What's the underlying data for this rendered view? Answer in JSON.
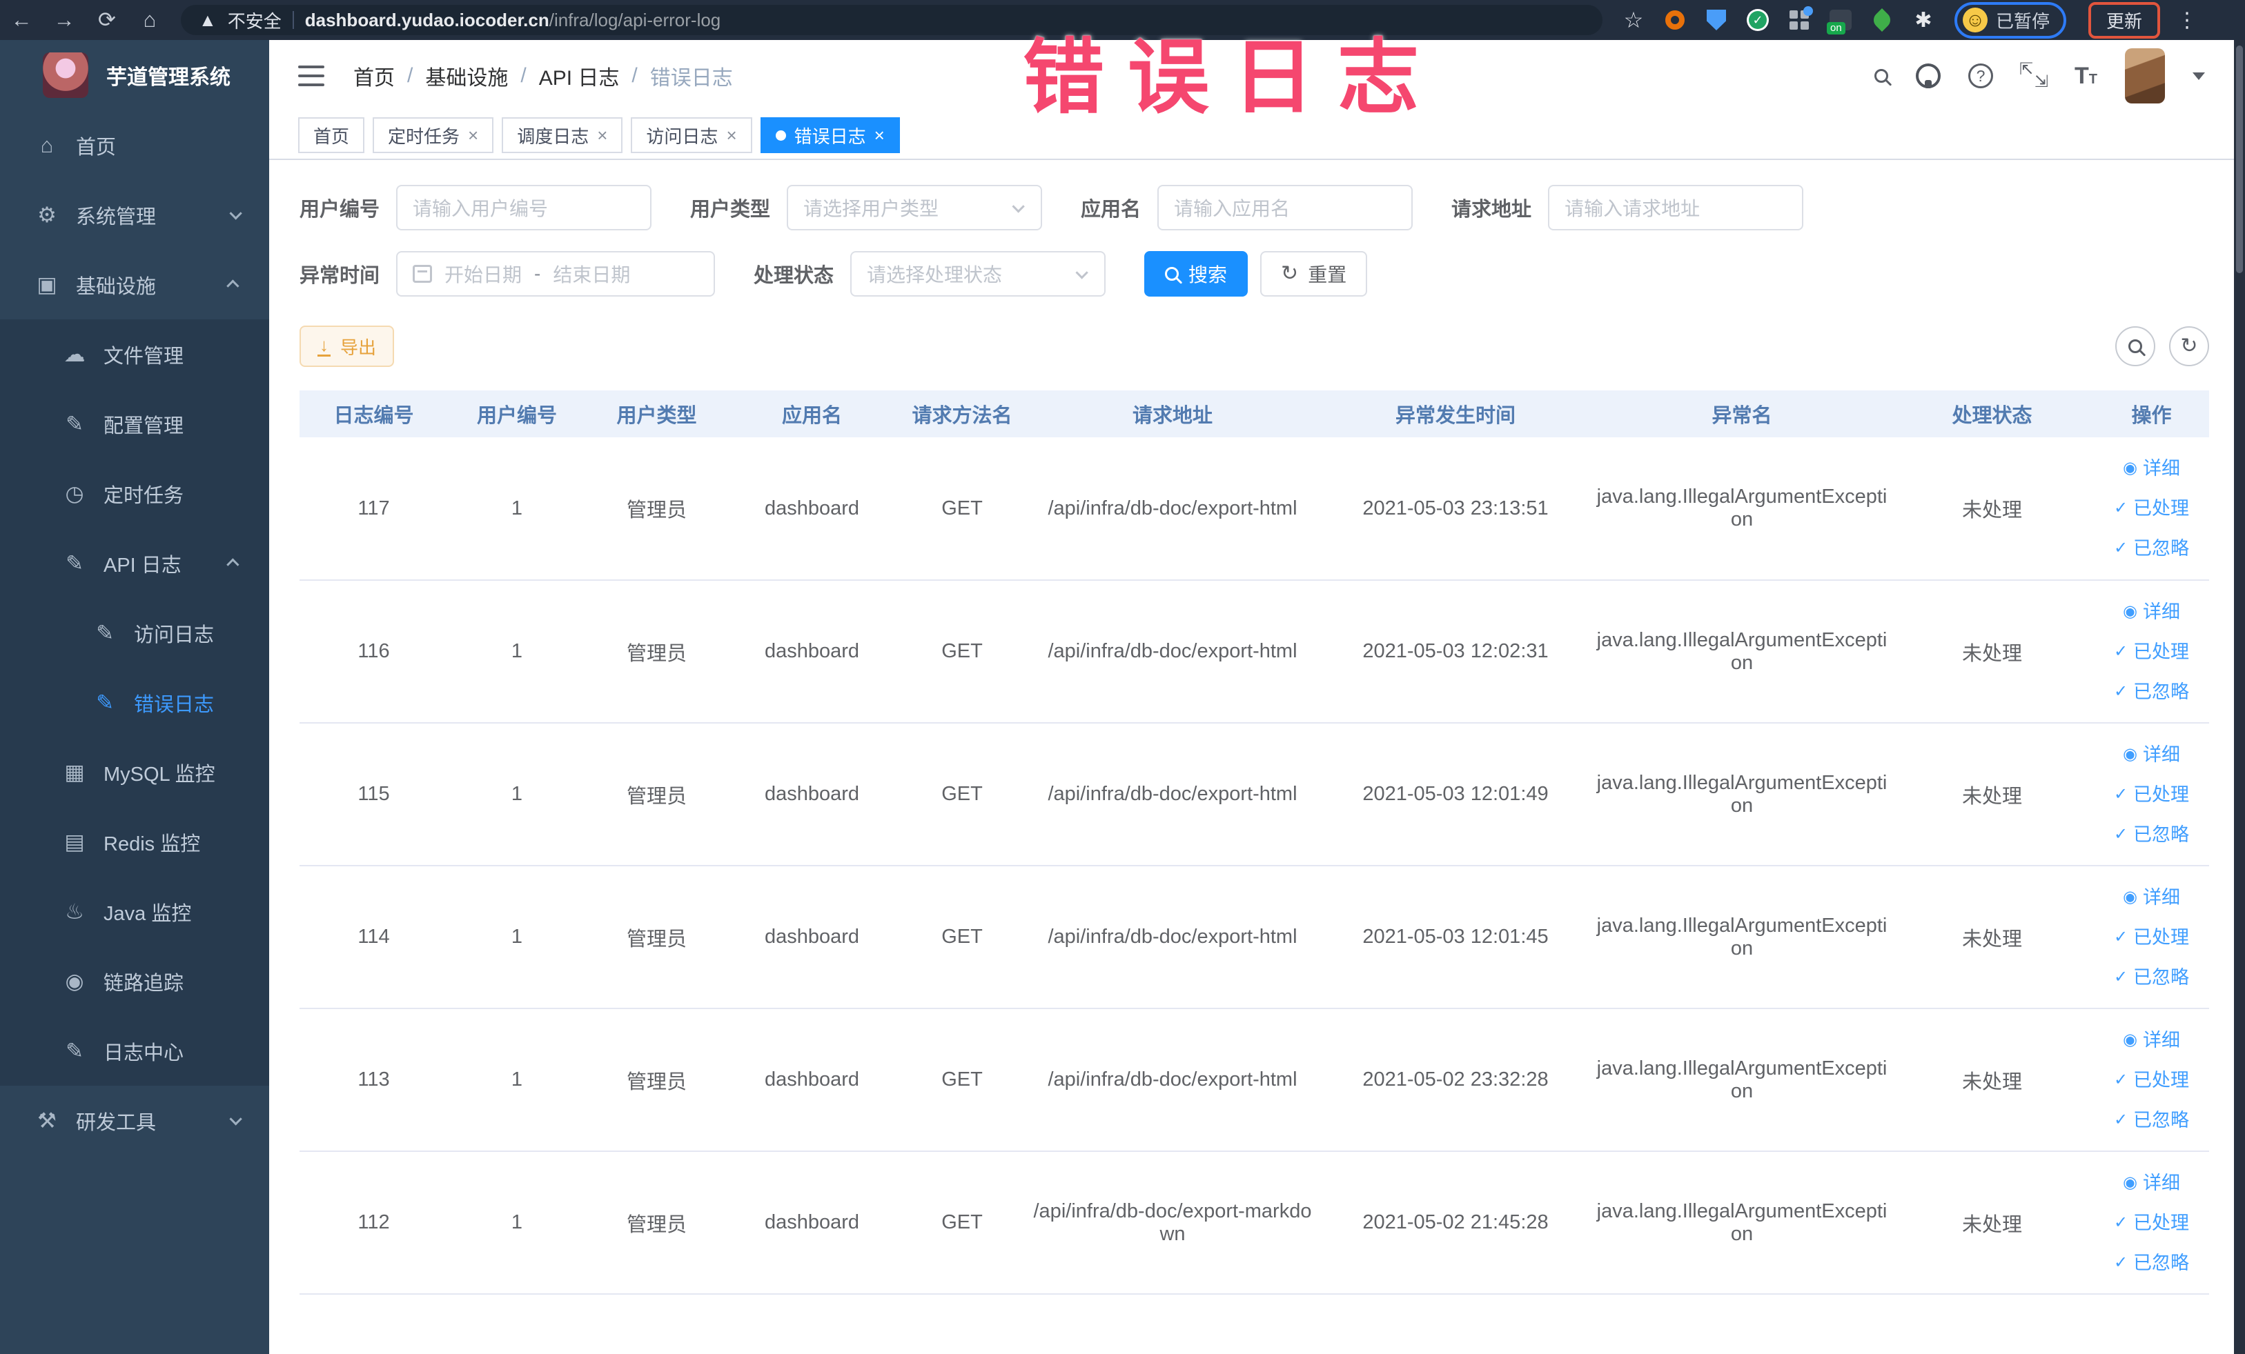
{
  "browser": {
    "security_label": "不安全",
    "url_domain": "dashboard.yudao.iocoder.cn",
    "url_path": "/infra/log/api-error-log",
    "on_badge": "on",
    "paused_label": "已暂停",
    "update_label": "更新",
    "extension_icons": [
      "bookmark-star-icon",
      "orange-ring-extension-icon",
      "blue-shield-extension-icon",
      "green-check-extension-icon",
      "grid-extension-icon",
      "on-badge-extension-icon",
      "leaf-extension-icon",
      "white-star-extension-icon"
    ]
  },
  "annotation": {
    "text": "错误日志",
    "color": "#f5476f"
  },
  "sidebar": {
    "title": "芋道管理系统",
    "items": [
      {
        "label": "首页",
        "icon": "home-icon",
        "depth": 0
      },
      {
        "label": "系统管理",
        "icon": "gear-icon",
        "depth": 0,
        "chevron": "down"
      },
      {
        "label": "基础设施",
        "icon": "infrastructure-icon",
        "depth": 0,
        "chevron": "up"
      },
      {
        "label": "文件管理",
        "icon": "file-manage-icon",
        "depth": 1
      },
      {
        "label": "配置管理",
        "icon": "config-manage-icon",
        "depth": 1
      },
      {
        "label": "定时任务",
        "icon": "scheduled-task-icon",
        "depth": 1
      },
      {
        "label": "API 日志",
        "icon": "api-log-icon",
        "depth": 1,
        "chevron": "up"
      },
      {
        "label": "访问日志",
        "icon": "access-log-icon",
        "depth": 2
      },
      {
        "label": "错误日志",
        "icon": "error-log-icon",
        "depth": 2,
        "active": true
      },
      {
        "label": "MySQL 监控",
        "icon": "mysql-monitor-icon",
        "depth": 1
      },
      {
        "label": "Redis 监控",
        "icon": "redis-monitor-icon",
        "depth": 1
      },
      {
        "label": "Java 监控",
        "icon": "java-monitor-icon",
        "depth": 1
      },
      {
        "label": "链路追踪",
        "icon": "trace-icon",
        "depth": 1
      },
      {
        "label": "日志中心",
        "icon": "log-center-icon",
        "depth": 1
      },
      {
        "label": "研发工具",
        "icon": "devtools-icon",
        "depth": 0,
        "chevron": "down"
      }
    ]
  },
  "navbar": {
    "breadcrumb": [
      "首页",
      "基础设施",
      "API 日志",
      "错误日志"
    ]
  },
  "tabs": [
    {
      "label": "首页",
      "closable": false,
      "active": false
    },
    {
      "label": "定时任务",
      "closable": true,
      "active": false
    },
    {
      "label": "调度日志",
      "closable": true,
      "active": false
    },
    {
      "label": "访问日志",
      "closable": true,
      "active": false
    },
    {
      "label": "错误日志",
      "closable": true,
      "active": true
    }
  ],
  "filters": {
    "user_id": {
      "label": "用户编号",
      "placeholder": "请输入用户编号"
    },
    "user_type": {
      "label": "用户类型",
      "placeholder": "请选择用户类型"
    },
    "app_name": {
      "label": "应用名",
      "placeholder": "请输入应用名"
    },
    "request_url": {
      "label": "请求地址",
      "placeholder": "请输入请求地址"
    },
    "time": {
      "label": "异常时间",
      "start_placeholder": "开始日期",
      "separator": "-",
      "end_placeholder": "结束日期"
    },
    "status": {
      "label": "处理状态",
      "placeholder": "请选择处理状态"
    },
    "search_label": "搜索",
    "reset_label": "重置"
  },
  "toolbar": {
    "export_label": "导出"
  },
  "table": {
    "headers": [
      "日志编号",
      "用户编号",
      "用户类型",
      "应用名",
      "请求方法名",
      "请求地址",
      "异常发生时间",
      "异常名",
      "处理状态",
      "操作"
    ],
    "actions": [
      "详细",
      "已处理",
      "已忽略"
    ],
    "rows": [
      {
        "id": "117",
        "user_id": "1",
        "user_type": "管理员",
        "app_name": "dashboard",
        "method": "GET",
        "url": "/api/infra/db-doc/export-html",
        "time": "2021-05-03 23:13:51",
        "exception": "java.lang.IllegalArgumentException",
        "status": "未处理"
      },
      {
        "id": "116",
        "user_id": "1",
        "user_type": "管理员",
        "app_name": "dashboard",
        "method": "GET",
        "url": "/api/infra/db-doc/export-html",
        "time": "2021-05-03 12:02:31",
        "exception": "java.lang.IllegalArgumentException",
        "status": "未处理"
      },
      {
        "id": "115",
        "user_id": "1",
        "user_type": "管理员",
        "app_name": "dashboard",
        "method": "GET",
        "url": "/api/infra/db-doc/export-html",
        "time": "2021-05-03 12:01:49",
        "exception": "java.lang.IllegalArgumentException",
        "status": "未处理"
      },
      {
        "id": "114",
        "user_id": "1",
        "user_type": "管理员",
        "app_name": "dashboard",
        "method": "GET",
        "url": "/api/infra/db-doc/export-html",
        "time": "2021-05-03 12:01:45",
        "exception": "java.lang.IllegalArgumentException",
        "status": "未处理"
      },
      {
        "id": "113",
        "user_id": "1",
        "user_type": "管理员",
        "app_name": "dashboard",
        "method": "GET",
        "url": "/api/infra/db-doc/export-html",
        "time": "2021-05-02 23:32:28",
        "exception": "java.lang.IllegalArgumentException",
        "status": "未处理"
      },
      {
        "id": "112",
        "user_id": "1",
        "user_type": "管理员",
        "app_name": "dashboard",
        "method": "GET",
        "url": "/api/infra/db-doc/export-markdown",
        "time": "2021-05-02 21:45:28",
        "exception": "java.lang.IllegalArgumentException",
        "status": "未处理"
      }
    ]
  },
  "colors": {
    "accent": "#409eff",
    "active_tab": "#1a90ff",
    "warning": "#e6a23c",
    "sidebar_bg": "#2e4459",
    "sidebar_submenu_bg": "#273a4e"
  }
}
